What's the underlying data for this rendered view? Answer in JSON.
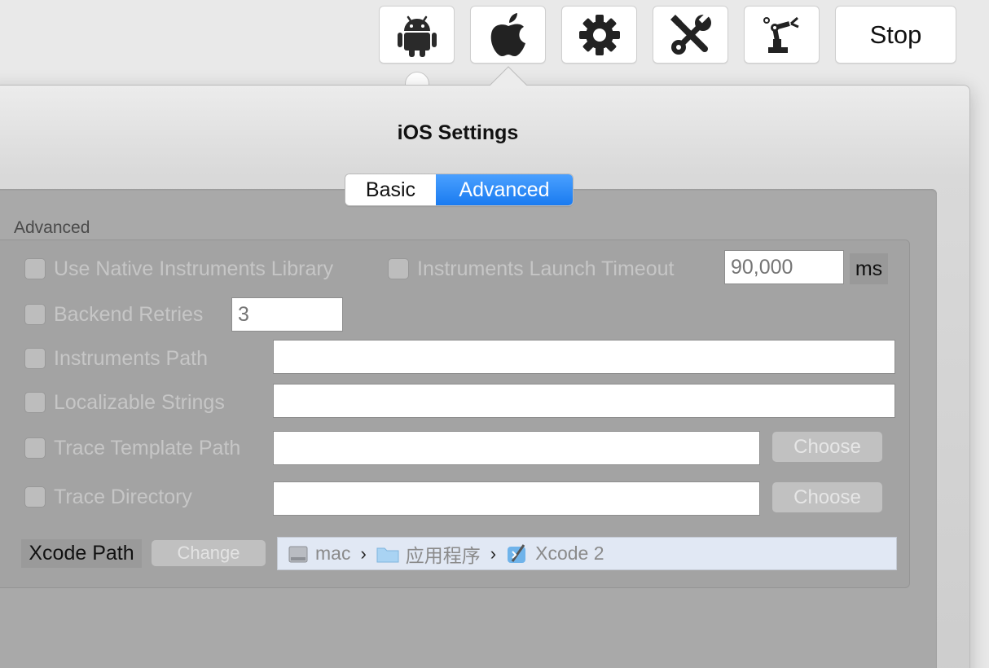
{
  "toolbar": {
    "buttons": [
      {
        "name": "android",
        "icon": "android-icon"
      },
      {
        "name": "apple",
        "icon": "apple-icon"
      },
      {
        "name": "settings",
        "icon": "gear-icon"
      },
      {
        "name": "tools",
        "icon": "wrench-screwdriver-icon"
      },
      {
        "name": "robot",
        "icon": "robot-arm-icon"
      }
    ],
    "stop_label": "Stop"
  },
  "dialog": {
    "title": "iOS Settings",
    "tabs": [
      {
        "label": "Basic",
        "selected": false
      },
      {
        "label": "Advanced",
        "selected": true
      }
    ],
    "section_label": "Advanced"
  },
  "settings": {
    "use_native_instruments": {
      "label": "Use Native Instruments Library",
      "checked": false
    },
    "instruments_launch_timeout": {
      "label": "Instruments Launch Timeout",
      "checked": false,
      "value": "",
      "placeholder": "90,000",
      "unit": "ms"
    },
    "backend_retries": {
      "label": "Backend Retries",
      "checked": false,
      "value": "",
      "placeholder": "3"
    },
    "instruments_path": {
      "label": "Instruments Path",
      "checked": false,
      "value": ""
    },
    "localizable_strings": {
      "label": "Localizable Strings",
      "checked": false,
      "value": ""
    },
    "trace_template_path": {
      "label": "Trace Template Path",
      "checked": false,
      "value": "",
      "button_label": "Choose"
    },
    "trace_directory": {
      "label": "Trace Directory",
      "checked": false,
      "value": "",
      "button_label": "Choose"
    }
  },
  "xcode": {
    "label": "Xcode Path",
    "change_label": "Change",
    "path": [
      {
        "label": "mac",
        "icon": "hard-drive-icon"
      },
      {
        "label": "应用程序",
        "icon": "folder-icon"
      },
      {
        "label": "Xcode 2",
        "icon": "xcode-icon"
      }
    ],
    "separator": "›"
  },
  "colors": {
    "accent": "#1a7bf0",
    "disabled_text": "#c6c6c6",
    "path_bar_bg": "#e1e8f4"
  }
}
